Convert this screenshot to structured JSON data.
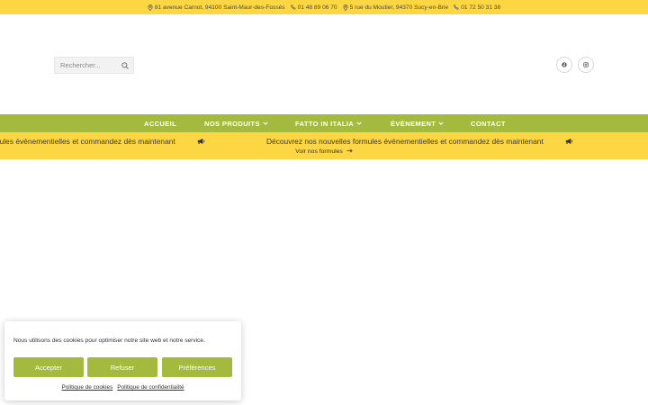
{
  "topbar": {
    "items": [
      {
        "icon": "map-pin-icon",
        "text": "81 avenue Carnot, 94100 Saint-Maur-des-Fossés"
      },
      {
        "icon": "phone-icon",
        "text": "01 48 89 06 70"
      },
      {
        "icon": "map-pin-icon",
        "text": "5 rue du Moutier, 94370 Sucy-en-Brie"
      },
      {
        "icon": "phone-icon",
        "text": "01 72 50 31 38"
      }
    ]
  },
  "search": {
    "placeholder": "Rechercher...",
    "icon": "search-icon"
  },
  "social": [
    "facebook-icon",
    "instagram-icon"
  ],
  "nav": {
    "items": [
      {
        "label": "ACCUEIL",
        "dropdown": false
      },
      {
        "label": "NOS PRODUITS",
        "dropdown": true
      },
      {
        "label": "FATTO IN ITALIA",
        "dropdown": true
      },
      {
        "label": "ÉVÈNEMENT",
        "dropdown": true
      },
      {
        "label": "CONTACT",
        "dropdown": false
      }
    ]
  },
  "promo": {
    "ticker_text": "Découvrez nos nouvelles formules événementielles et commandez dès maintenant",
    "ticker_icon": "megaphone-icon",
    "link_label": "Voir nos formules",
    "link_icon": "arrow-right-icon"
  },
  "cookie": {
    "message": "Nous utilisons des cookies pour optimiser notre site web et notre service.",
    "accept": "Accepter",
    "refuse": "Refuser",
    "preferences": "Préférences",
    "cookie_policy": "Politique de cookies",
    "privacy_policy": "Politique de confidentialité"
  },
  "colors": {
    "yellow": "#fdd743",
    "green": "#a4ba3f"
  }
}
